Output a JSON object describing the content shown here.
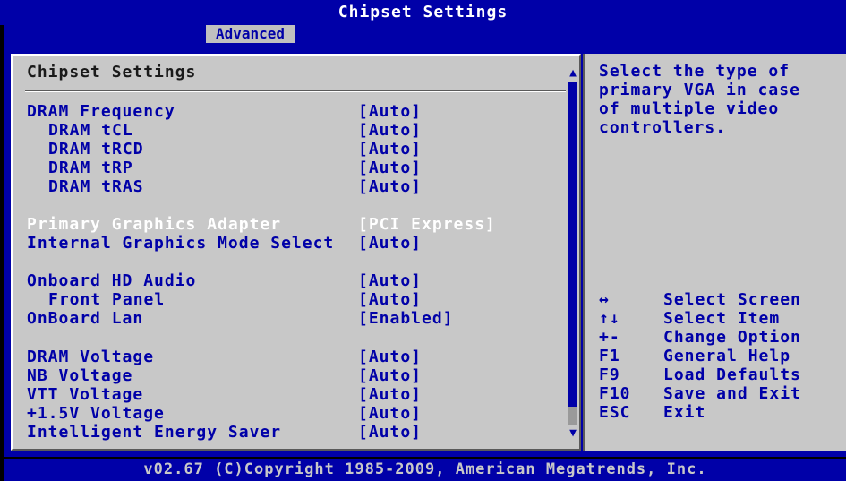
{
  "header": {
    "title": "Chipset Settings"
  },
  "tabs": [
    {
      "label": "Advanced",
      "active": true
    }
  ],
  "main": {
    "title": "Chipset Settings",
    "rows": [
      {
        "label": "DRAM Frequency",
        "value": "[Auto]"
      },
      {
        "label": "DRAM tCL",
        "value": "[Auto]"
      },
      {
        "label": "DRAM tRCD",
        "value": "[Auto]"
      },
      {
        "label": "DRAM tRP",
        "value": "[Auto]"
      },
      {
        "label": "DRAM tRAS",
        "value": "[Auto]"
      },
      {
        "label": "Primary Graphics Adapter",
        "value": "[PCI Express]"
      },
      {
        "label": "Internal Graphics Mode Select",
        "value": "[Auto]"
      },
      {
        "label": "Onboard HD Audio",
        "value": "[Auto]"
      },
      {
        "label": "Front Panel",
        "value": "[Auto]"
      },
      {
        "label": "OnBoard Lan",
        "value": "[Enabled]"
      },
      {
        "label": "DRAM Voltage",
        "value": "[Auto]"
      },
      {
        "label": "NB Voltage",
        "value": "[Auto]"
      },
      {
        "label": "VTT Voltage",
        "value": "[Auto]"
      },
      {
        "label": "+1.5V Voltage",
        "value": "[Auto]"
      },
      {
        "label": "Intelligent Energy Saver",
        "value": "[Auto]"
      }
    ]
  },
  "help": {
    "text": "Select the type of\nprimary VGA in case\nof multiple video\ncontrollers.",
    "keys": [
      {
        "key": "↔",
        "desc": "Select Screen"
      },
      {
        "key": "↑↓",
        "desc": "Select Item"
      },
      {
        "key": "+-",
        "desc": "Change Option"
      },
      {
        "key": "F1",
        "desc": "General Help"
      },
      {
        "key": "F9",
        "desc": "Load Defaults"
      },
      {
        "key": "F10",
        "desc": "Save and Exit"
      },
      {
        "key": "ESC",
        "desc": "Exit"
      }
    ]
  },
  "footer": {
    "text": "v02.67 (C)Copyright 1985-2009, American Megatrends, Inc."
  },
  "scrollbar": {
    "up_icon": "▲",
    "down_icon": "▼"
  },
  "colors": {
    "bios_blue": "#0000a8",
    "panel_gray": "#c8c8c8",
    "selected_text": "#ffffff"
  }
}
